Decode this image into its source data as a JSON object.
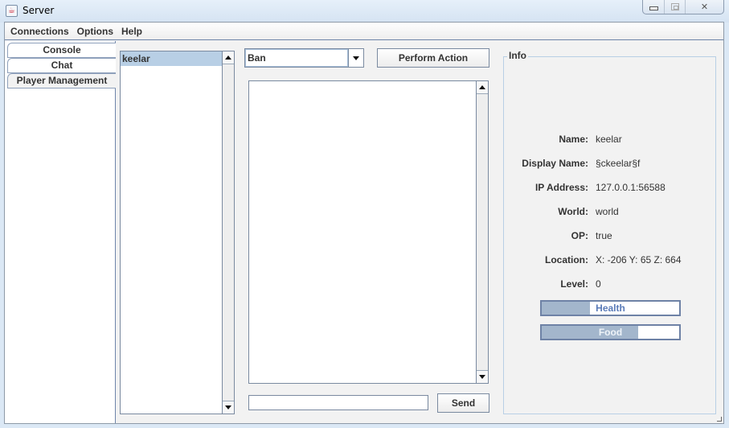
{
  "window": {
    "title": "Server",
    "app_icon": "java-cup-icon",
    "controls": {
      "minimize": "minimize-icon",
      "maximize": "maximize-icon",
      "close": "close-icon"
    }
  },
  "menubar": {
    "items": [
      {
        "label": "Connections"
      },
      {
        "label": "Options"
      },
      {
        "label": "Help"
      }
    ]
  },
  "tabs": [
    {
      "label": "Console",
      "selected": false
    },
    {
      "label": "Chat",
      "selected": false
    },
    {
      "label": "Player Management",
      "selected": true
    }
  ],
  "players": {
    "items": [
      {
        "name": "keelar",
        "selected": true
      }
    ]
  },
  "actions": {
    "selected": "Ban",
    "perform_label": "Perform Action"
  },
  "message": {
    "input_value": "",
    "send_label": "Send"
  },
  "info": {
    "title": "Info",
    "rows": [
      {
        "label": "Name:",
        "value": "keelar"
      },
      {
        "label": "Display Name:",
        "value": "§ckeelar§f"
      },
      {
        "label": "IP Address:",
        "value": "127.0.0.1:56588"
      },
      {
        "label": "World:",
        "value": "world"
      },
      {
        "label": "OP:",
        "value": "true"
      },
      {
        "label": "Location:",
        "value": "X: -206 Y: 65 Z: 664"
      },
      {
        "label": "Level:",
        "value": "0"
      }
    ],
    "health": {
      "label": "Health",
      "percent": 35
    },
    "food": {
      "label": "Food",
      "percent": 70
    }
  },
  "colors": {
    "selection": "#b8cfe5",
    "bar_fill": "#a3b6cc",
    "border_accent": "#6e85aa"
  }
}
